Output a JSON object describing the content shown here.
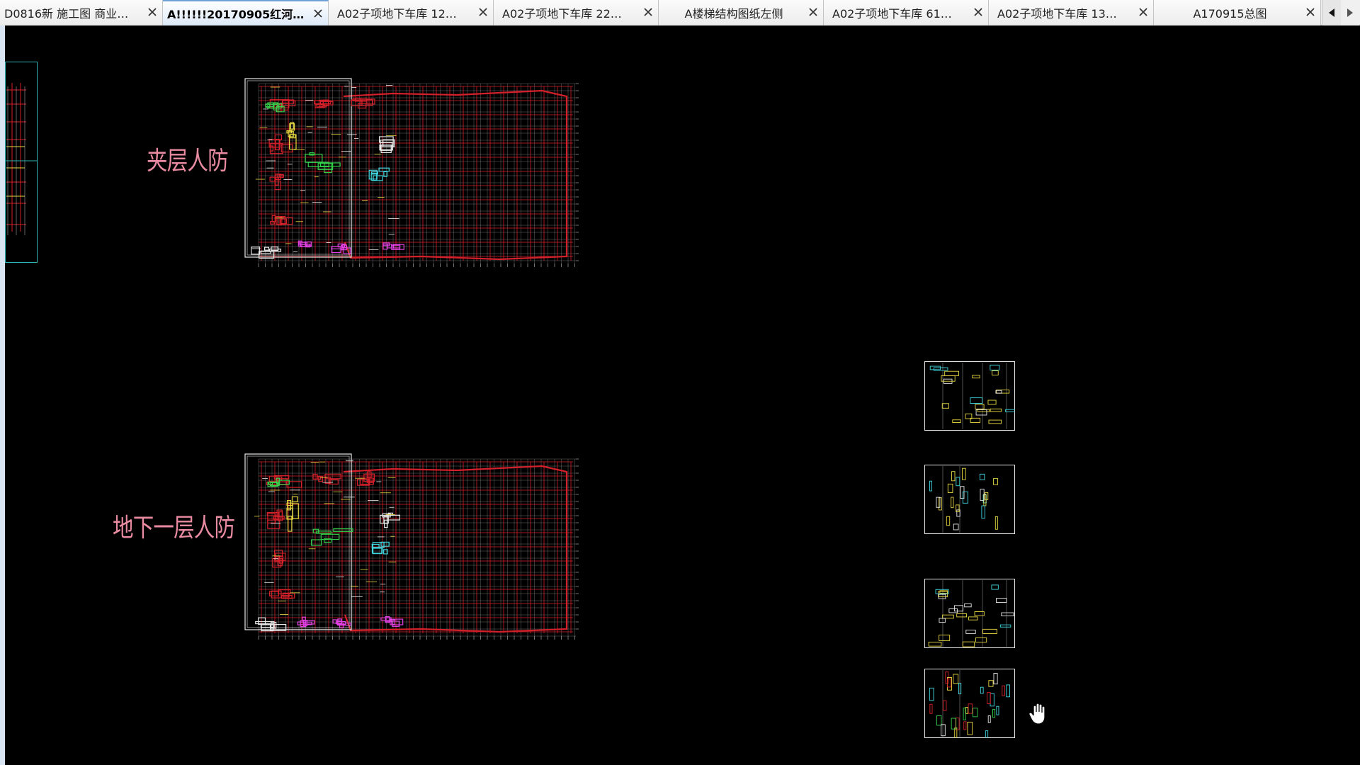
{
  "tabs": [
    {
      "label": "D0816新 施工图 商业…",
      "active": false
    },
    {
      "label": "A!!!!!!20170905红河…",
      "active": true
    },
    {
      "label": "A02子项地下车库  12…",
      "active": false
    },
    {
      "label": "A02子项地下车库  22…",
      "active": false
    },
    {
      "label": "A楼梯结构图纸左侧",
      "active": false
    },
    {
      "label": "A02子项地下车库  61…",
      "active": false
    },
    {
      "label": "A02子项地下车库  13…",
      "active": false
    },
    {
      "label": "A170915总图",
      "active": false
    }
  ],
  "tab_icons": {
    "close": "close-icon",
    "scroll_left": "triangle-left-icon",
    "scroll_right": "triangle-right-icon"
  },
  "drawing": {
    "label_mezzanine": "夹层人防",
    "label_basement": "地下一层人防",
    "sheet_count": 4
  },
  "colors": {
    "background": "#000000",
    "label": "#e88aa0",
    "grid_red": "#d4202a",
    "grid_white": "#e8e8e8",
    "green": "#33d04a",
    "magenta": "#e040e0",
    "yellow": "#e8d840",
    "cyan": "#40d8e0"
  },
  "cursor": "hand-cursor-icon"
}
